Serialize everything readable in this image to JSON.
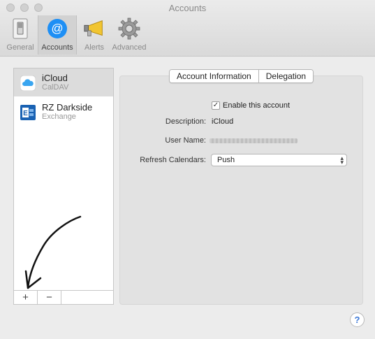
{
  "window": {
    "title": "Accounts"
  },
  "toolbar": {
    "items": [
      {
        "label": "General",
        "icon": "switch-icon"
      },
      {
        "label": "Accounts",
        "icon": "at-sign-icon"
      },
      {
        "label": "Alerts",
        "icon": "megaphone-icon"
      },
      {
        "label": "Advanced",
        "icon": "gear-icon"
      }
    ],
    "selected": "Accounts"
  },
  "accounts": [
    {
      "name": "iCloud",
      "type": "CalDAV",
      "icon": "cloud-icon"
    },
    {
      "name": "RZ Darkside",
      "type": "Exchange",
      "icon": "exchange-icon"
    }
  ],
  "list_footer": {
    "add": "+",
    "remove": "−"
  },
  "tabs": [
    "Account Information",
    "Delegation"
  ],
  "form": {
    "enable_label": "Enable this account",
    "enable_checked": true,
    "description_label": "Description:",
    "description_value": "iCloud",
    "username_label": "User Name:",
    "refresh_label": "Refresh Calendars:",
    "refresh_value": "Push"
  },
  "help": "?",
  "colors": {
    "accent": "#1e8ff5",
    "exchange": "#1a62b3"
  }
}
